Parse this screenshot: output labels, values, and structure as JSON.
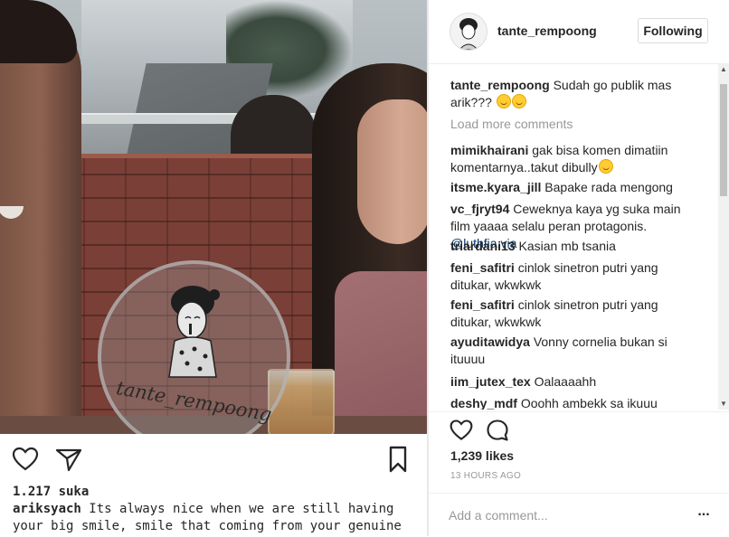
{
  "photo": {
    "watermark_text": "tante_rempoong",
    "likes": "1.217 suka",
    "caption_user": "ariksyach",
    "caption_text": "Its always nice when we are still having your big smile, smile that coming from your genuine heart."
  },
  "post": {
    "username": "tante_rempoong",
    "follow_label": "Following",
    "caption_user": "tante_rempoong",
    "caption_text": "Sudah go publik mas arik???",
    "load_more": "Load more comments",
    "comments": [
      {
        "user": "mimikhairani",
        "text": "gak bisa komen dimatiin komentarnya..takut dibully"
      },
      {
        "user": "itsme.kyara_jill",
        "text": "Bapake rada mengong"
      },
      {
        "user": "vc_fjryt94",
        "text": "Ceweknya kaya yg suka main film yaaaa selalu peran protagonis.",
        "mention": "@luthfia.via"
      },
      {
        "user": "triardani13",
        "text": "Kasian mb tsania"
      },
      {
        "user": "feni_safitri",
        "text": "cinlok sinetron putri yang ditukar, wkwkwk"
      },
      {
        "user": "feni_safitri",
        "text": "cinlok sinetron putri yang ditukar, wkwkwk"
      },
      {
        "user": "ayuditawidya",
        "text": "Vonny cornelia bukan si ituuuu"
      },
      {
        "user": "iim_jutex_tex",
        "text": "Oalaaaahh"
      },
      {
        "user": "deshy_mdf",
        "text": "Ooohh ambekk sa ikuuu"
      }
    ],
    "likes": "1,239 likes",
    "time": "13 HOURS AGO",
    "add_comment_placeholder": "Add a comment...",
    "more_label": "..."
  },
  "icons": {
    "like": "heart-icon",
    "comment": "comment-bubble-icon",
    "share": "paper-plane-icon",
    "save": "bookmark-icon"
  }
}
